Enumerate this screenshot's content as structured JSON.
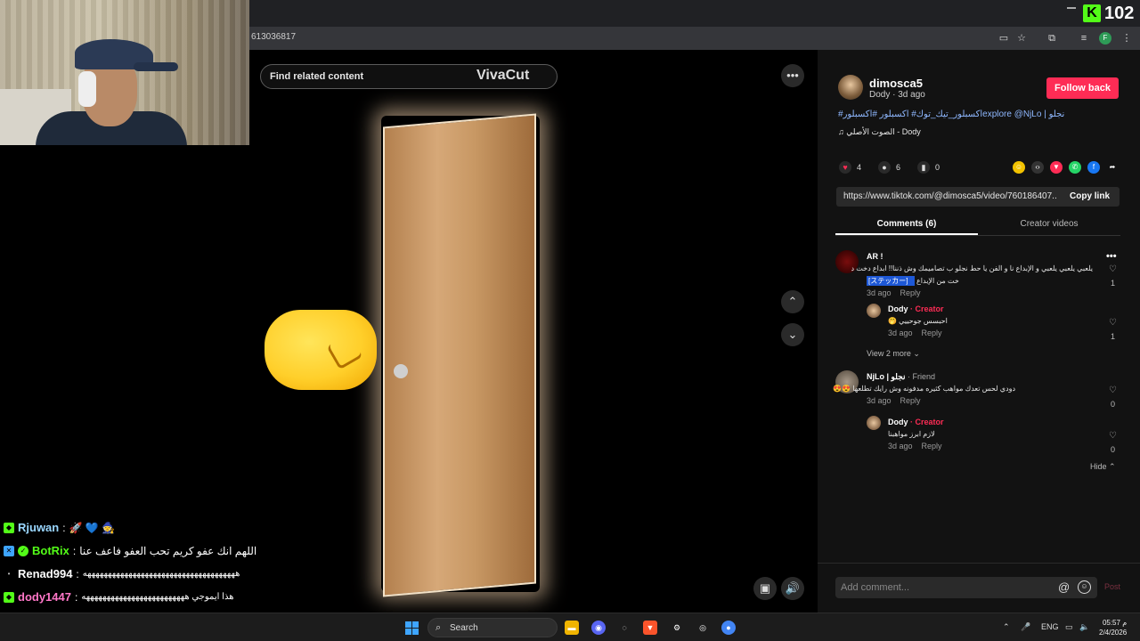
{
  "browser": {
    "url": "613036817",
    "viewer_count": "102",
    "kick_logo": "K"
  },
  "video": {
    "find_related": "Find related content",
    "watermark": "VivaCut"
  },
  "post": {
    "author_name": "dimosca5",
    "author_meta": "Dody · 3d ago",
    "follow_label": "Follow back",
    "caption": "#اكسبلور_تيك_توك# اكسبلور #اكسبلورexplore @NjLo | نجلو",
    "music": "الصوت الأصلي - Dody",
    "likes": "4",
    "comments_count": "6",
    "saves": "0",
    "link": "https://www.tiktok.com/@dimosca5/video/760186407...",
    "copy_label": "Copy link",
    "tab_comments": "Comments (6)",
    "tab_creator": "Creator videos",
    "accent": "#fe2c55"
  },
  "comments": [
    {
      "name": "AR !",
      "text_line1": "يلعبي يلعبي يلعبي و الإبداع نا و الفن يا حط نجلو ب تصاميمك وش ذننا!! ابداع دخت د",
      "highlight": "[ステッカー]",
      "text_line2": "خت من الإبداع",
      "time": "3d ago",
      "reply": "Reply",
      "likes": "1"
    },
    {
      "name": "Dody",
      "role": " · Creator",
      "text": "احبسس جوحييي 🤭",
      "time": "3d ago",
      "reply": "Reply",
      "likes": "1"
    },
    {
      "view_more": "View 2 more"
    },
    {
      "name": "NjLo | نجلو",
      "role": " · Friend",
      "text": "دودي لحس تعدك مواهب كثيره مدفونه وش رايك تطلعها 😍😍",
      "time": "3d ago",
      "reply": "Reply",
      "likes": "0"
    },
    {
      "name": "Dody",
      "role": " · Creator",
      "text": "لازم ابرز مواهبنا",
      "time": "3d ago",
      "reply": "Reply",
      "likes": "0",
      "hide": "Hide"
    }
  ],
  "composer": {
    "placeholder": "Add comment...",
    "post_label": "Post"
  },
  "chat": [
    {
      "user": "Rjuwan",
      "sep": " :",
      "msg": "🚀 💙 🧙",
      "color": "#9ad7ff"
    },
    {
      "user": "BotRix",
      "sep": " :",
      "msg": "اللهم انك عفو كريم تحب العفو فاعف عنا",
      "color": "#53fc18"
    },
    {
      "user": "Renad994",
      "sep": " :",
      "msg": "هههههههههههههههههههههههههههههههههههههه",
      "color": "#ffffff"
    },
    {
      "user": "dody1447",
      "sep": " :",
      "msg": "هذا ايموجي هههههههههههههههههههههههههه",
      "color": "#ff77c8"
    }
  ],
  "taskbar": {
    "search": "Search",
    "lang": "ENG",
    "time": "05:57 م",
    "date": "2/4/2026"
  }
}
